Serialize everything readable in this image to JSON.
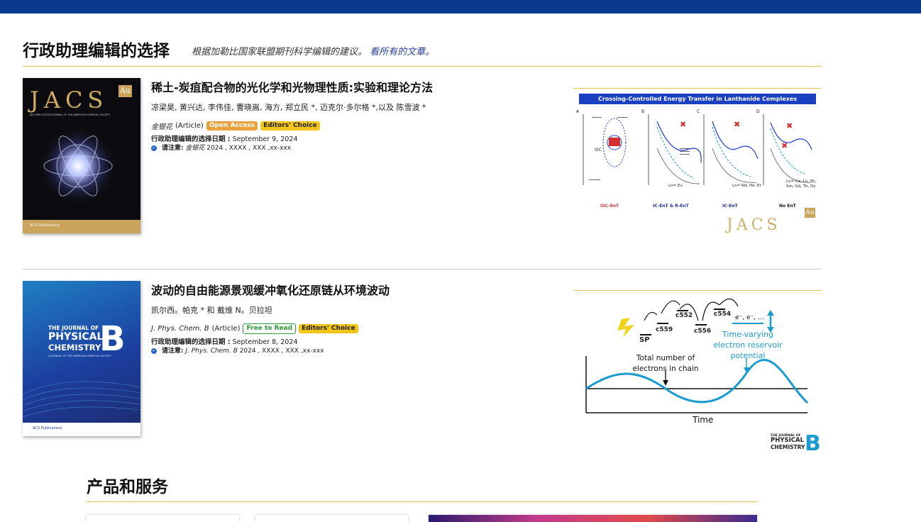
{
  "header": {
    "title": "行政助理编辑的选择",
    "subtitle": "根据加勒比国家联盟期刊科学编辑的建议。",
    "link": "看所有的文章。"
  },
  "articles": [
    {
      "title": "稀土-炭疽配合物的光化学和光物理性质:实验和理论方法",
      "authors": "凉梁昊, 黄兴达, 李伟佳, 曹晓嵩, 海方, 郑立民 *, 迈克尔·多尔格 *,以及 陈雪波 *",
      "journal": "金银花",
      "type": "(Article)",
      "badges": [
        "Open Access",
        "Editors' Choice"
      ],
      "date_label": "行政助理编辑的选择日期 :",
      "date": "September 9, 2024",
      "cite_label": "请注意:",
      "cite_journal": "金银花",
      "cite_rest": "2024 , XXXX , XXX ,xx-xxx",
      "cover": {
        "brand": "JACS",
        "sub": "Au",
        "tagline": "AN OPEN ACCESS JOURNAL OF THE AMERICAN CHEMICAL SOCIETY",
        "footer": "ACS Publications"
      },
      "toc": {
        "title": "Crossing-Controlled Energy Transfer in Lanthanide Complexes",
        "panels": [
          "A",
          "B",
          "C",
          "D"
        ],
        "captions": [
          "ISC-EnT",
          "IC-EnT & R-EnT",
          "IC-EnT",
          "No EnT"
        ],
        "lanthanides": [
          "Ln= Eu",
          "Ln= Nd, Ho, Er",
          "Ln= Ce, Ln, Yb, Sm, Gd, Tb, Dy"
        ],
        "logo": "JACS",
        "logo_sub": "Au"
      }
    },
    {
      "title": "波动的自由能源景观缓冲氧化还原链从环境波动",
      "authors": "凯尔西。帕克 * 和 戴维 N。贝拉坦",
      "journal": "J. Phys. Chem. B",
      "type": "(Article)",
      "badges": [
        "Free to Read",
        "Editors' Choice"
      ],
      "date_label": "行政助理编辑的选择日期 :",
      "date": "September 8, 2024",
      "cite_label": "请注意:",
      "cite_journal": "J. Phys. Chem. B",
      "cite_rest": "2024 , XXXX , XXX ,xx-xxx",
      "cover": {
        "line1": "THE JOURNAL OF",
        "line2": "PHYSICAL",
        "line3": "CHEMISTRY",
        "letter": "B",
        "tagline": "A JOURNAL OF THE AMERICAN CHEMICAL SOCIETY",
        "footer": "ACS Publications"
      },
      "toc": {
        "labels": [
          "SP",
          "c559",
          "c552",
          "c556",
          "c554"
        ],
        "electrons": "e⁻, e⁻, ...",
        "reservoir": "Time-varying electron reservoir potential",
        "total": "Total number of electrons in chain",
        "xaxis": "Time",
        "logo1": "THE JOURNAL OF",
        "logo2": "PHYSICAL",
        "logo3": "CHEMISTRY",
        "logo_letter": "B"
      }
    }
  ],
  "products": {
    "title": "产品和服务"
  },
  "colors": {
    "topbar": "#0a3a8c",
    "accent_rule": "#e3c24a",
    "link": "#2a3f9a"
  }
}
